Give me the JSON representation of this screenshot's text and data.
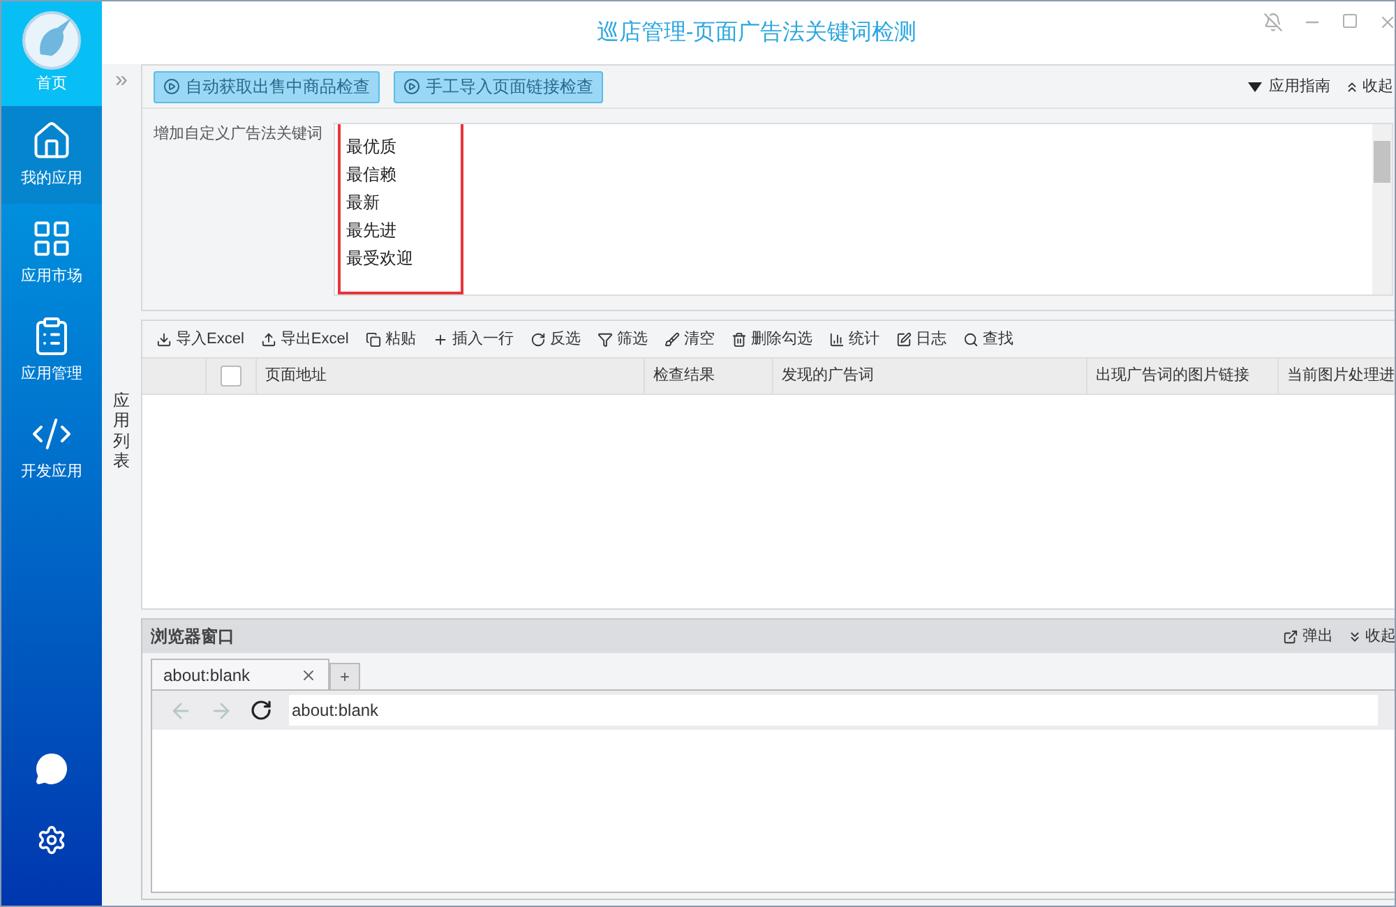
{
  "window": {
    "title": "巡店管理-页面广告法关键词检测"
  },
  "sidebar": {
    "home": "首页",
    "items": [
      {
        "label": "我的应用",
        "selected": true
      },
      {
        "label": "应用市场",
        "selected": false
      },
      {
        "label": "应用管理",
        "selected": false
      },
      {
        "label": "开发应用",
        "selected": false
      }
    ]
  },
  "collapse_strip": {
    "expand": "»",
    "label": "应用列表"
  },
  "top_panel": {
    "buttons": [
      "自动获取出售中商品检查",
      "手工导入页面链接检查"
    ],
    "guide": "应用指南",
    "collapse": "收起",
    "keyword_label": "增加自定义广告法关键词",
    "keywords": [
      "最优质",
      "最信赖",
      "最新",
      "最先进",
      "最受欢迎"
    ]
  },
  "toolbar": [
    "导入Excel",
    "导出Excel",
    "粘贴",
    "插入一行",
    "反选",
    "筛选",
    "清空",
    "删除勾选",
    "统计",
    "日志",
    "查找"
  ],
  "table": {
    "select_all_checked": false,
    "columns": [
      "页面地址",
      "检查结果",
      "发现的广告词",
      "出现广告词的图片链接",
      "当前图片处理进"
    ]
  },
  "browser": {
    "title": "浏览器窗口",
    "popout": "弹出",
    "collapse": "收起",
    "tabs": [
      {
        "label": "about:blank",
        "selected": true
      }
    ],
    "new_tab": "+",
    "back_disabled": true,
    "forward_disabled": true,
    "address": "about:blank"
  }
}
